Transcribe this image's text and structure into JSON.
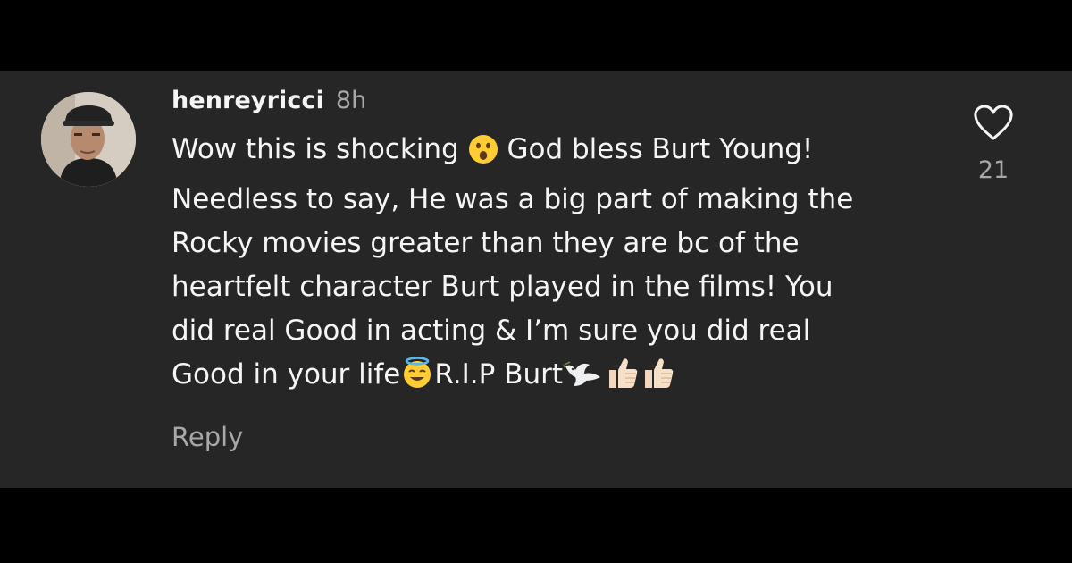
{
  "comment": {
    "username": "henreyricci",
    "timestamp": "8h",
    "text_lines": [
      "Wow this is shocking",
      "God bless Burt Young!",
      "Needless to say, He was a big part of making the",
      "Rocky movies greater than they are bc of the",
      "heartfelt character Burt played in the films! You",
      "did real Good in acting & I’m sure you did real",
      "Good in your life",
      "R.I.P Burt"
    ],
    "reply_label": "Reply",
    "like_count": "21",
    "emojis": [
      "hushed-face-emoji",
      "smiling-face-with-halo-emoji",
      "dove-emoji",
      "thumbs-up-light-skin-emoji",
      "thumbs-up-light-skin-emoji"
    ]
  },
  "colors": {
    "page_background": "#000000",
    "panel_background": "#262626",
    "primary_text": "#f5f5f5",
    "secondary_text": "#a8a8a8"
  }
}
